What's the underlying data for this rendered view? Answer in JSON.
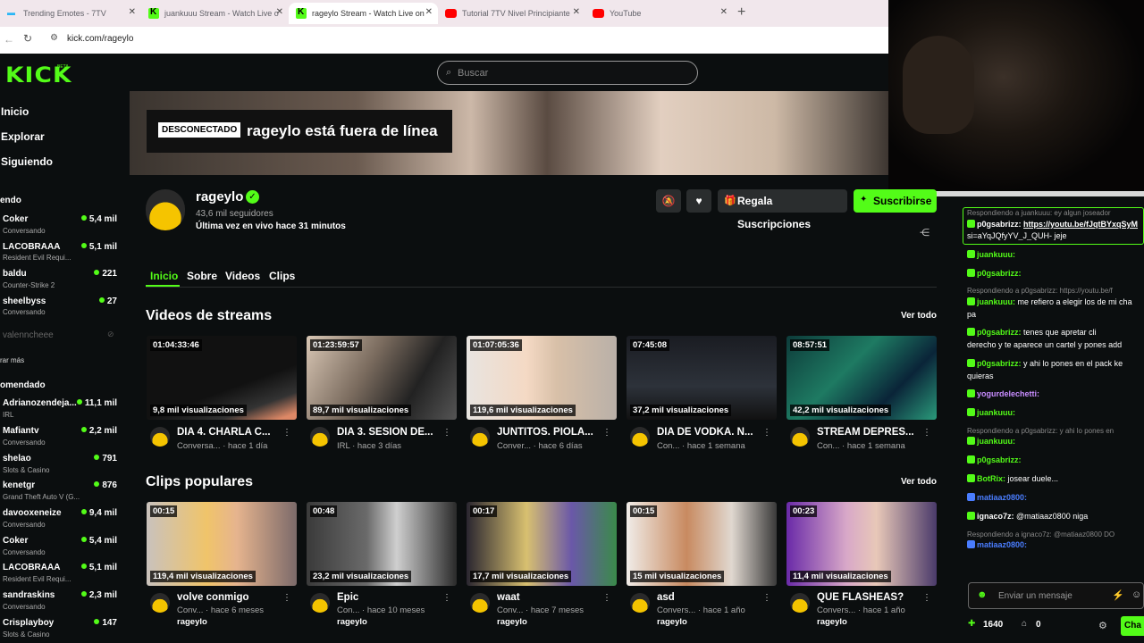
{
  "browser": {
    "tabs": [
      {
        "title": "Trending Emotes - 7TV"
      },
      {
        "title": "juankuuu Stream - Watch Live o"
      },
      {
        "title": "rageylo Stream - Watch Live on"
      },
      {
        "title": "Tutorial 7TV Nivel Principiante"
      },
      {
        "title": "YouTube"
      }
    ],
    "url": "kick.com/rageylo"
  },
  "kick": {
    "logo": "KICK",
    "beta": "BETA",
    "search_placeholder": "Buscar",
    "brand_color": "#53fc18"
  },
  "sidebar": {
    "nav": [
      "Inicio",
      "Explorar",
      "Siguiendo"
    ],
    "following_header": "endo",
    "following": [
      {
        "name": "Coker",
        "sub": "Conversando",
        "count": "5,4 mil"
      },
      {
        "name": "LACOBRAAA",
        "sub": "Resident Evil Requi...",
        "count": "5,1 mil"
      },
      {
        "name": "baldu",
        "sub": "Counter-Strike 2",
        "count": "221"
      },
      {
        "name": "sheelbyss",
        "sub": "Conversando",
        "count": "27"
      },
      {
        "name": "valenncheee",
        "sub": "",
        "count": ""
      }
    ],
    "show_more": "rar más",
    "recommended_header": "omendado",
    "recommended": [
      {
        "name": "Adrianozendeja...",
        "sub": "IRL",
        "count": "11,1 mil"
      },
      {
        "name": "Mafiantv",
        "sub": "Conversando",
        "count": "2,2 mil"
      },
      {
        "name": "shelao",
        "sub": "Slots & Casino",
        "count": "791"
      },
      {
        "name": "kenetgr",
        "sub": "Grand Theft Auto V (G...",
        "count": "876"
      },
      {
        "name": "davooxeneize",
        "sub": "Conversando",
        "count": "9,4 mil"
      },
      {
        "name": "Coker",
        "sub": "Conversando",
        "count": "5,4 mil"
      },
      {
        "name": "LACOBRAAA",
        "sub": "Resident Evil Requi...",
        "count": "5,1 mil"
      },
      {
        "name": "sandraskins",
        "sub": "Conversando",
        "count": "2,3 mil"
      },
      {
        "name": "Crisplayboy",
        "sub": "Slots & Casino",
        "count": "147"
      }
    ]
  },
  "channel": {
    "offline_badge": "DESCONECTADO",
    "offline_text": "rageylo está fuera de línea",
    "name": "rageylo",
    "followers": "43,6 mil seguidores",
    "last_live": "Última vez en vivo hace 31 minutos",
    "gift_label": "Regala Suscripciones",
    "subscribe_label": "Suscribirse",
    "tabs": [
      "Inicio",
      "Sobre",
      "Videos",
      "Clips"
    ]
  },
  "streams": {
    "title": "Videos de streams",
    "see_all": "Ver todo",
    "items": [
      {
        "duration": "01:04:33:46",
        "views": "9,8 mil visualizaciones",
        "title": "DIA 4. CHARLA C...",
        "category": "Conversa...",
        "ago": "hace 1 día"
      },
      {
        "duration": "01:23:59:57",
        "views": "89,7 mil visualizaciones",
        "title": "DIA 3. SESION DE...",
        "category": "IRL",
        "ago": "hace 3 días"
      },
      {
        "duration": "01:07:05:36",
        "views": "119,6 mil visualizaciones",
        "title": "JUNTITOS. PIOLA...",
        "category": "Conver...",
        "ago": "hace 6 días"
      },
      {
        "duration": "07:45:08",
        "views": "37,2 mil visualizaciones",
        "title": "DIA DE VODKA. N...",
        "category": "Con...",
        "ago": "hace 1 semana"
      },
      {
        "duration": "08:57:51",
        "views": "42,2 mil visualizaciones",
        "title": "STREAM DEPRES...",
        "category": "Con...",
        "ago": "hace 1 semana"
      }
    ]
  },
  "clips": {
    "title": "Clips populares",
    "see_all": "Ver todo",
    "items": [
      {
        "duration": "00:15",
        "views": "119,4 mil visualizaciones",
        "title": "volve conmigo",
        "category": "Conv...",
        "ago": "hace 6 meses",
        "user": "rageylo"
      },
      {
        "duration": "00:48",
        "views": "23,2 mil visualizaciones",
        "title": "Epic",
        "category": "Con...",
        "ago": "hace 10 meses",
        "user": "rageylo"
      },
      {
        "duration": "00:17",
        "views": "17,7 mil visualizaciones",
        "title": "waat",
        "category": "Conv...",
        "ago": "hace 7 meses",
        "user": "rageylo"
      },
      {
        "duration": "00:15",
        "views": "15 mil visualizaciones",
        "title": "asd",
        "category": "Convers...",
        "ago": "hace 1 año",
        "user": "rageylo"
      },
      {
        "duration": "00:23",
        "views": "11,4 mil visualizaciones",
        "title": "QUE FLASHEAS?",
        "category": "Convers...",
        "ago": "hace 1 año",
        "user": "rageylo"
      }
    ]
  },
  "chat": {
    "messages": [
      {
        "type": "reply",
        "text": "Respondiendo a juankuuu: ey algun joseador"
      },
      {
        "type": "msg",
        "user": "p0gsabrizz:",
        "text": "https://youtu.be/fJqtBYxqSyM",
        "color": "#ffffff"
      },
      {
        "type": "cont",
        "text": "si=aYqJQfyYV_J_QUH- jeje"
      },
      {
        "type": "msg",
        "user": "juankuuu:",
        "text": "",
        "color": "#53fc18"
      },
      {
        "type": "msg",
        "user": "p0gsabrizz:",
        "text": "",
        "color": "#53fc18"
      },
      {
        "type": "reply",
        "text": "Respondiendo a p0gsabrizz: https://youtu.be/f"
      },
      {
        "type": "msg",
        "user": "juankuuu:",
        "text": "me refiero a elegir los de mi cha",
        "color": "#53fc18"
      },
      {
        "type": "cont",
        "text": "pa"
      },
      {
        "type": "msg",
        "user": "p0gsabrizz:",
        "text": "tenes que apretar cli",
        "color": "#53fc18"
      },
      {
        "type": "cont",
        "text": "derecho y te aparece un cartel y pones add"
      },
      {
        "type": "msg",
        "user": "p0gsabrizz:",
        "text": "y ahi lo pones en el pack ke",
        "color": "#53fc18"
      },
      {
        "type": "cont",
        "text": "quieras"
      },
      {
        "type": "msg",
        "user": "yogurdelechetti:",
        "text": "",
        "color": "#c88cff"
      },
      {
        "type": "msg",
        "user": "juankuuu:",
        "text": "",
        "color": "#53fc18"
      },
      {
        "type": "reply",
        "text": "Respondiendo a p0gsabrizz: y ahi lo pones en"
      },
      {
        "type": "msg",
        "user": "juankuuu:",
        "text": "",
        "color": "#53fc18"
      },
      {
        "type": "msg",
        "user": "p0gsabrizz:",
        "text": "",
        "color": "#53fc18"
      },
      {
        "type": "msg",
        "user": "BotRix:",
        "text": "josear duele...",
        "color": "#53fc18"
      },
      {
        "type": "msg",
        "user": "matiaaz0800:",
        "text": "",
        "color": "#4a7dff"
      },
      {
        "type": "msg",
        "user": "ignaco7z:",
        "text": "@matiaaz0800 niga",
        "color": "#ffffff"
      },
      {
        "type": "reply",
        "text": "Respondiendo a ignaco7z: @matiaaz0800 DO"
      },
      {
        "type": "msg",
        "user": "matiaaz0800:",
        "text": "",
        "color": "#4a7dff"
      }
    ],
    "input_placeholder": "Enviar un mensaje",
    "points": "1640",
    "points2": "0",
    "send_label": "Cha"
  }
}
